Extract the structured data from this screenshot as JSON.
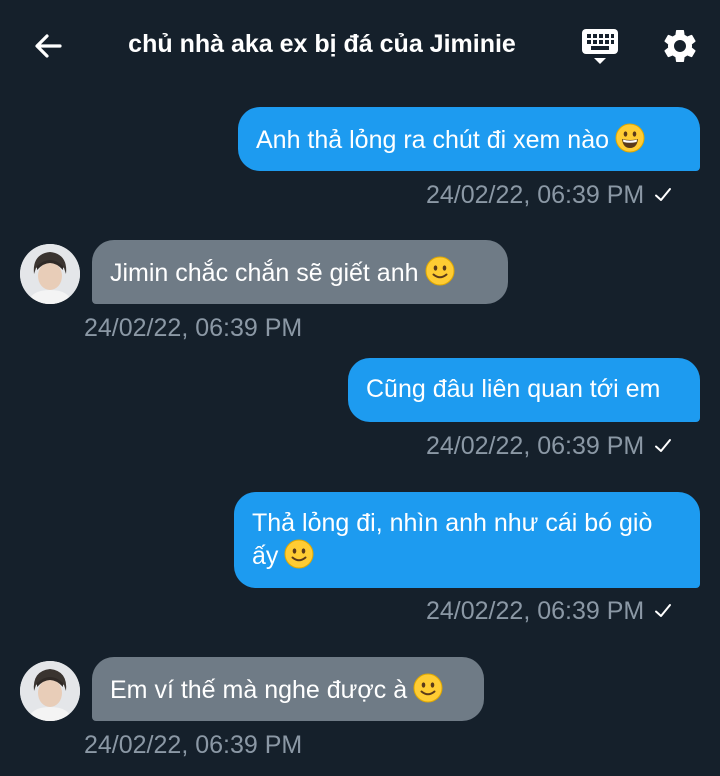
{
  "header": {
    "title": "chủ nhà aka ex bị đá của Jiminie",
    "back_icon": "arrow-left-icon",
    "keyboard_icon": "keyboard-icon",
    "settings_icon": "gear-icon"
  },
  "colors": {
    "background": "#15202b",
    "outgoing_bubble": "#1d9bf0",
    "incoming_bubble": "#6f7b86",
    "timestamp": "#8b98a5"
  },
  "messages": [
    {
      "direction": "outgoing",
      "text": "Anh thả lỏng ra chút đi xem nào",
      "emoji": "grinning-face",
      "time": "24/02/22, 06:39 PM",
      "read": true
    },
    {
      "direction": "incoming",
      "text": "Jimin chắc chắn sẽ giết anh",
      "emoji": "slightly-smiling-face",
      "time": "24/02/22, 06:39 PM"
    },
    {
      "direction": "outgoing",
      "text": "Cũng đâu liên quan tới em",
      "time": "24/02/22, 06:39 PM",
      "read": true
    },
    {
      "direction": "outgoing",
      "text": "Thả lỏng đi, nhìn anh như cái bó giò ấy",
      "emoji": "slightly-smiling-face",
      "time": "24/02/22, 06:39 PM",
      "read": true
    },
    {
      "direction": "incoming",
      "text": "Em ví thế mà nghe được à",
      "emoji": "slightly-smiling-face",
      "time": "24/02/22, 06:39 PM"
    }
  ]
}
